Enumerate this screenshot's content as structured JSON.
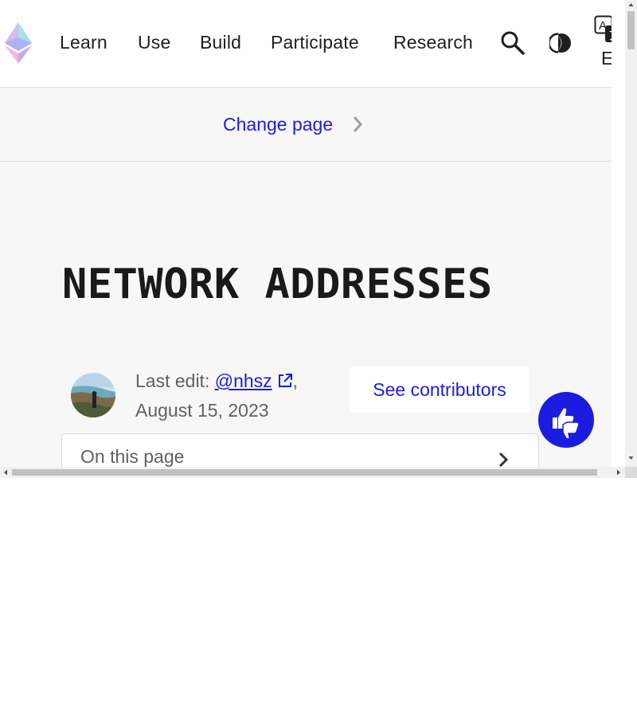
{
  "header": {
    "logo_icon": "ethereum-logo-icon",
    "nav": [
      "Learn",
      "Use",
      "Build",
      "Participate",
      "Research"
    ],
    "search_icon": "search-icon",
    "theme_icon": "dark-mode-icon",
    "language_icon": "translate-icon",
    "language_code": "EN"
  },
  "change_page": {
    "label": "Change page",
    "icon": "chevron-right-icon"
  },
  "page": {
    "title": "NETWORK ADDRESSES"
  },
  "meta": {
    "last_edit_prefix": "Last edit: ",
    "author": "@nhsz",
    "separator": ",",
    "date": "August 15, 2023",
    "external_icon": "external-link-icon",
    "contributors_button": "See contributors"
  },
  "toc": {
    "label": "On this page",
    "icon": "chevron-right-icon"
  },
  "feedback": {
    "icon": "thumbs-up-down-icon"
  },
  "colors": {
    "primary": "#1c1ce1",
    "background": "#f7f7f7",
    "text": "#1f1f1f",
    "muted": "#616161"
  }
}
